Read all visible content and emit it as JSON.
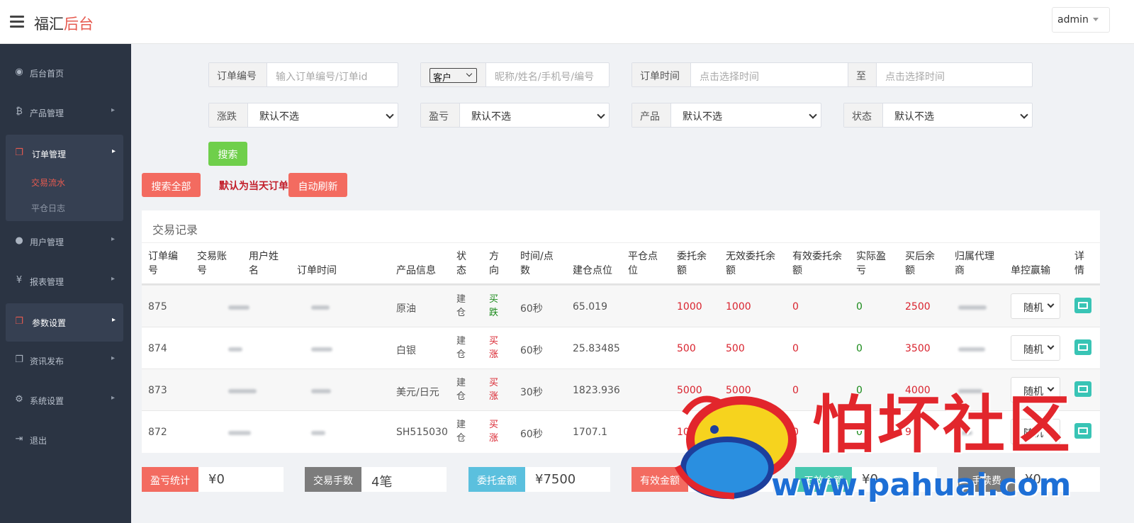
{
  "header": {
    "brand_main": "福汇",
    "brand_accent": "后台",
    "user": "admin",
    "menu_icon": "hamburger-icon"
  },
  "sidebar": {
    "items": [
      {
        "label": "后台首页",
        "icon": "dashboard-icon"
      },
      {
        "label": "产品管理",
        "icon": "bitcoin-icon"
      },
      {
        "label": "订单管理",
        "icon": "copy-icon"
      },
      {
        "label": "交易流水"
      },
      {
        "label": "平仓日志"
      },
      {
        "label": "用户管理",
        "icon": "user-icon"
      },
      {
        "label": "报表管理",
        "icon": "yen-icon"
      },
      {
        "label": "参数设置",
        "icon": "copy-icon"
      },
      {
        "label": "资讯发布",
        "icon": "copy-icon"
      },
      {
        "label": "系统设置",
        "icon": "cogs-icon"
      },
      {
        "label": "退出",
        "icon": "sign-out-icon"
      }
    ]
  },
  "filters": {
    "order_no": {
      "label": "订单编号",
      "placeholder": "输入订单编号/订单id"
    },
    "customer": {
      "select": "客户",
      "placeholder": "昵称/姓名/手机号/编号"
    },
    "order_time": {
      "label": "订单时间",
      "placeholder_from": "点击选择时间",
      "to_label": "至",
      "placeholder_to": "点击选择时间"
    },
    "rise_fall": {
      "label": "涨跌",
      "value": "默认不选"
    },
    "profit_loss": {
      "label": "盈亏",
      "value": "默认不选"
    },
    "product": {
      "label": "产品",
      "value": "默认不选"
    },
    "status": {
      "label": "状态",
      "value": "默认不选"
    },
    "search_button": "搜索",
    "search_all_button": "搜索全部",
    "default_note": "默认为当天订单",
    "auto_refresh_button": "自动刷新"
  },
  "table": {
    "title": "交易记录",
    "headers": [
      "订单编\n号",
      "交易账\n号",
      "用户姓\n名",
      "订单时间",
      "产品信息",
      "状\n态",
      "方\n向",
      "时间/点\n数",
      "建仓点位",
      "平仓点\n位",
      "委托余\n额",
      "无效委托余\n额",
      "有效委托余\n额",
      "实际盈\n亏",
      "买后余\n额",
      "归属代理\n商",
      "单控赢输",
      "详\n情"
    ],
    "rows": [
      {
        "id": "875",
        "product": "原油",
        "status": "建\n仓",
        "direction": "买\n跌",
        "dir_color": "green",
        "duration": "60秒",
        "open_price": "65.019",
        "close_price": "",
        "entrust": "1000",
        "invalid": "1000",
        "valid": "0",
        "pnl": "0",
        "balance": "2500",
        "control": "随机"
      },
      {
        "id": "874",
        "product": "白银",
        "status": "建\n仓",
        "direction": "买\n涨",
        "dir_color": "red",
        "duration": "60秒",
        "open_price": "25.83485",
        "close_price": "",
        "entrust": "500",
        "invalid": "500",
        "valid": "0",
        "pnl": "0",
        "balance": "3500",
        "control": "随机"
      },
      {
        "id": "873",
        "product": "美元/日元",
        "status": "建\n仓",
        "direction": "买\n涨",
        "dir_color": "red",
        "duration": "30秒",
        "open_price": "1823.936",
        "close_price": "",
        "entrust": "5000",
        "invalid": "5000",
        "valid": "0",
        "pnl": "0",
        "balance": "4000",
        "control": "随机"
      },
      {
        "id": "872",
        "product": "SH515030",
        "status": "建\n仓",
        "direction": "买\n涨",
        "dir_color": "red",
        "duration": "60秒",
        "open_price": "1707.1",
        "close_price": "",
        "entrust": "10",
        "invalid": "10",
        "valid": "0",
        "pnl": "0",
        "balance": "9",
        "control": "随机"
      }
    ]
  },
  "stats": [
    {
      "label": "盈亏统计",
      "value": "¥0",
      "color": "#f36b60"
    },
    {
      "label": "交易手数",
      "value": "4笔",
      "color": "#7c7c7c"
    },
    {
      "label": "委托金额",
      "value": "¥7500",
      "color": "#5bc0de"
    },
    {
      "label": "有效金额",
      "value": "",
      "color": "#f36b60"
    },
    {
      "label": "无效金额",
      "value": "¥0",
      "color": "#47c8b0"
    },
    {
      "label": "手续费",
      "value": "¥0",
      "color": "#7c7c7c"
    }
  ],
  "watermark": {
    "text_cn": "怕坏社区",
    "text_url": "www.pahuai.com"
  },
  "colors": {
    "sidebar": "#2b3443",
    "accent": "#e65a4f",
    "search": "#6fcf4b",
    "red_btn": "#f36b60"
  }
}
